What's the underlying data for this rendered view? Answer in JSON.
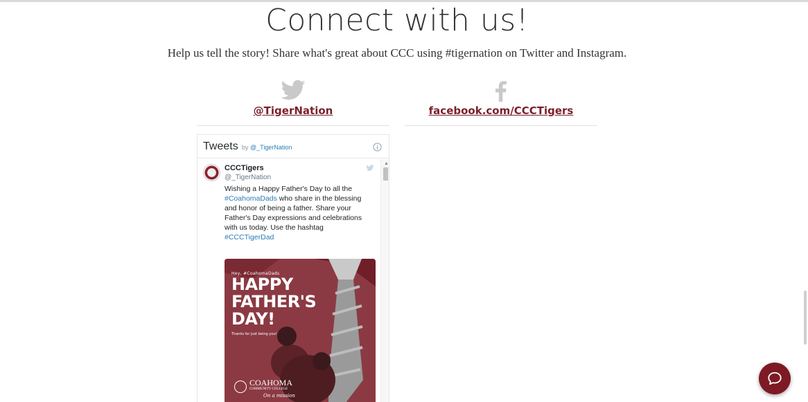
{
  "page": {
    "heading": "Connect with us!",
    "subtext": "Help us tell the story!  Share what's great about CCC using #tigernation on Twitter and Instagram."
  },
  "social": {
    "twitter": {
      "icon": "twitter-bird-icon",
      "label": "@TigerNation"
    },
    "facebook": {
      "icon": "facebook-icon",
      "label": "facebook.com/CCCTigers"
    }
  },
  "widget": {
    "title": "Tweets",
    "by_prefix": "by",
    "by_handle": "@_TigerNation",
    "info_icon": "info-icon"
  },
  "tweet": {
    "name": "CCCTigers",
    "handle": "@_TigerNation",
    "text_1": "Wishing a Happy Father's Day to all the",
    "tag_1": "#CoahomaDads",
    "text_2": " who share in the blessing and honor of being a father. Share your Father's Day expressions and celebrations with us today. Use the hashtag",
    "tag_2": "#CCCTigerDad"
  },
  "poster": {
    "small_line": "Hey, #CoahomaDads",
    "line1": "HAPPY",
    "line2": "FATHER'S",
    "line3": "DAY!",
    "thanks": "Thanks for just being you!",
    "college": "COAHOMA",
    "college_sub": "COMMUNITY COLLEGE",
    "script": "On a mission"
  },
  "chat": {
    "icon": "chat-bubble-icon"
  },
  "colors": {
    "brand": "#7a1f2b",
    "link_blue": "#2b7bb9",
    "poster_bg": "#8b3a44",
    "chat_button": "#7e1a23"
  }
}
